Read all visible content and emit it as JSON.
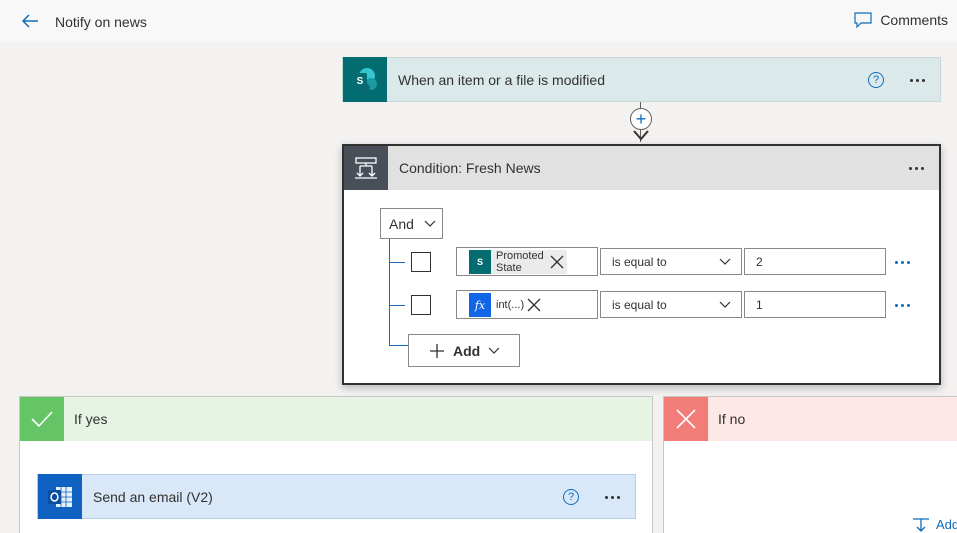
{
  "header": {
    "title": "Notify on news",
    "comments_label": "Comments"
  },
  "trigger": {
    "label": "When an item or a file is modified",
    "icon_letter": "S"
  },
  "condition": {
    "label": "Condition: Fresh News",
    "group_operator": "And",
    "rows": [
      {
        "token_label": "Promoted State",
        "operator": "is equal to",
        "value": "2"
      },
      {
        "token_label": "int(...)",
        "operator": "is equal to",
        "value": "1"
      }
    ],
    "add_label": "Add"
  },
  "branches": {
    "yes_label": "If yes",
    "no_label": "If no",
    "add_action_label": "Add"
  },
  "email_action": {
    "label": "Send an email (V2)"
  },
  "colors": {
    "sharepoint": "#036c70",
    "outlook": "#0f62c1",
    "yes": "#65c465",
    "no": "#f17c78",
    "accent": "#0f6cbd"
  }
}
